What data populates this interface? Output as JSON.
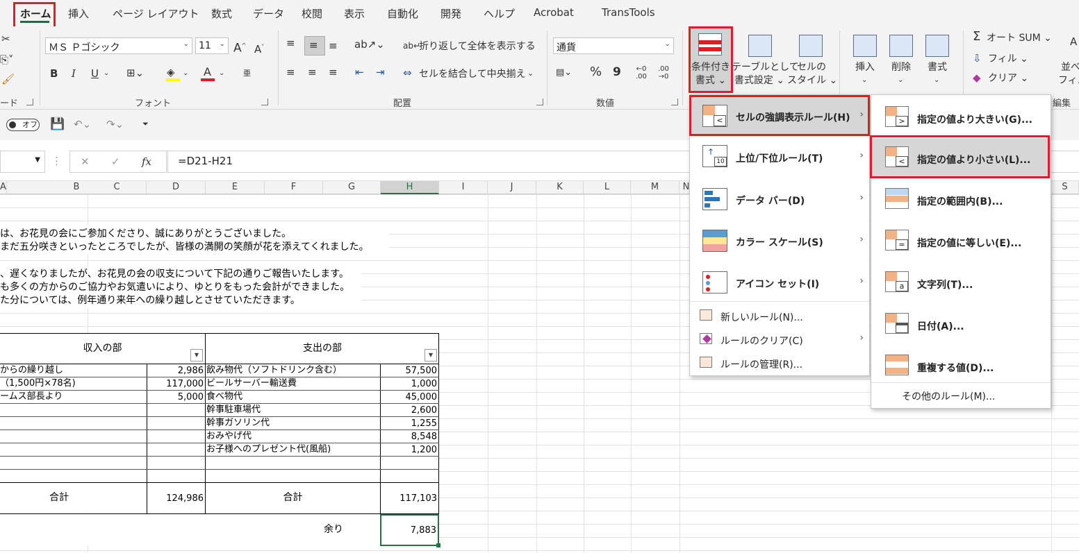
{
  "ribbon_tabs": [
    "ホーム",
    "挿入",
    "ページ レイアウト",
    "数式",
    "データ",
    "校閲",
    "表示",
    "自動化",
    "開発",
    "ヘルプ",
    "Acrobat",
    "TransTools"
  ],
  "font_group": {
    "font_name": "ＭＳ Ｐゴシック",
    "font_size": "11",
    "label": "フォント",
    "clipboard_label": "ード",
    "bold": "B",
    "italic": "I",
    "underline": "U",
    "grow": "A",
    "shrink": "A",
    "font_color": "A",
    "phonetic": "亜"
  },
  "align_group": {
    "wrap_text": "折り返して全体を表示する",
    "merge_center": "セルを結合して中央揃え",
    "label": "配置"
  },
  "number_group": {
    "format": "通貨",
    "percent": "%",
    "comma": "9",
    "inc_decimal": ".00",
    "dec_decimal": ".00",
    "label": "数値"
  },
  "styles_group": {
    "conditional_line1": "条件付き",
    "conditional_line2": "書式",
    "table_line1": "テーブルとして",
    "table_line2": "書式設定",
    "cell_line1": "セルの",
    "cell_line2": "スタイル"
  },
  "cells_group": {
    "insert": "挿入",
    "delete": "削除",
    "format": "書式"
  },
  "edit_group": {
    "autosum": "オート SUM",
    "fill": "フィル",
    "clear": "クリア",
    "sort_line1": "並べ",
    "sort_line2": "フィル",
    "label": "編集"
  },
  "qat": {
    "autosave": "オフ"
  },
  "formula_bar": {
    "formula": "=D21-H21",
    "fx": "fx"
  },
  "columns": [
    "A",
    "B",
    "C",
    "D",
    "E",
    "F",
    "G",
    "H",
    "I",
    "J",
    "K",
    "L",
    "M",
    "N"
  ],
  "column_S": "S",
  "sheet_text": [
    "は、お花見の会にご参加くださり、誠にありがとうございました。",
    "まだ五分咲きといったところでしたが、皆様の満開の笑顔が花を添えてくれました。",
    "、遅くなりましたが、お花見の会の収支について下記の通りご報告いたします。",
    "も多くの方からのご協力やお気遣いにより、ゆとりをもった会計ができました。",
    "た分については、例年通り来年への繰り越しとさせていただきます。"
  ],
  "table": {
    "income_header": "収入の部",
    "expense_header": "支出の部",
    "income_rows": [
      {
        "label": "からの繰り越し",
        "value": "2,986"
      },
      {
        "label": "（1,500円×78名)",
        "value": "117,000"
      },
      {
        "label": "ームス部長より",
        "value": "5,000"
      }
    ],
    "expense_rows": [
      {
        "label": "飲み物代（ソフトドリンク含む）",
        "value": "57,500"
      },
      {
        "label": "ビールサーバー輸送費",
        "value": "1,000"
      },
      {
        "label": "食べ物代",
        "value": "45,000"
      },
      {
        "label": "幹事駐車場代",
        "value": "2,600"
      },
      {
        "label": "幹事ガソリン代",
        "value": "1,255"
      },
      {
        "label": "おみやげ代",
        "value": "8,548"
      },
      {
        "label": "お子様へのプレゼント代(風船)",
        "value": "1,200"
      }
    ],
    "income_total_label": "合計",
    "income_total": "124,986",
    "expense_total_label": "合計",
    "expense_total": "117,103",
    "remainder_label": "余り",
    "remainder": "7,883"
  },
  "cf_menu": {
    "items": [
      {
        "label": "セルの強調表示ルール(H)"
      },
      {
        "label": "上位/下位ルール(T)"
      },
      {
        "label": "データ バー(D)"
      },
      {
        "label": "カラー スケール(S)"
      },
      {
        "label": "アイコン セット(I)"
      }
    ],
    "small_items": [
      {
        "label": "新しいルール(N)..."
      },
      {
        "label": "ルールのクリア(C)"
      },
      {
        "label": "ルールの管理(R)..."
      }
    ],
    "top10_icon_text": "10"
  },
  "sub_menu": {
    "items": [
      {
        "label": "指定の値より大きい(G)..."
      },
      {
        "label": "指定の値より小さい(L)..."
      },
      {
        "label": "指定の範囲内(B)..."
      },
      {
        "label": "指定の値に等しい(E)..."
      },
      {
        "label": "文字列(T)..."
      },
      {
        "label": "日付(A)..."
      },
      {
        "label": "重複する値(D)..."
      }
    ],
    "more": "その他のルール(M)...",
    "text_icon_letter": "a"
  },
  "colors": {
    "highlight_red": "#e31c24",
    "excel_green": "#217346"
  }
}
